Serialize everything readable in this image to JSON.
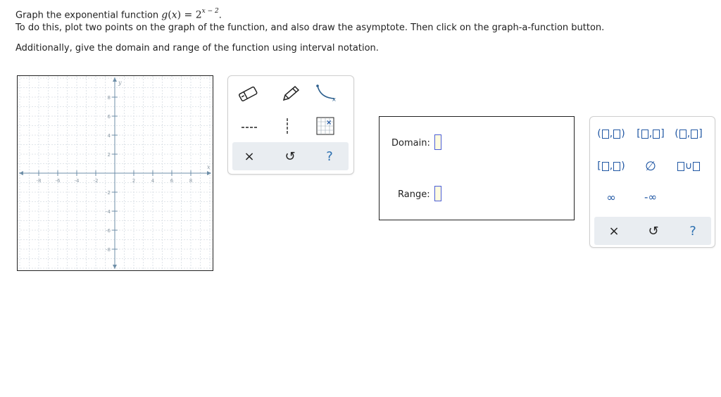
{
  "question": {
    "line1_prefix": "Graph the exponential function ",
    "func_name": "g",
    "func_var": "x",
    "func_eq": " = 2",
    "func_exponent": "x − 2",
    "func_end": ".",
    "line2": "To do this, plot two points on the graph of the function, and also draw the asymptote. Then click on the graph-a-function button.",
    "line3": "Additionally, give the domain and range of the function using interval notation."
  },
  "graph": {
    "x_axis_label": "x",
    "y_axis_label": "y",
    "x_ticks": [
      "-8",
      "-6",
      "-4",
      "-2",
      "2",
      "4",
      "6",
      "8"
    ],
    "y_ticks": [
      "8",
      "6",
      "4",
      "2",
      "-2",
      "-4",
      "-6",
      "-8"
    ],
    "axis_color": "#6f8fa8",
    "grid_color": "#d6dde3"
  },
  "tools": {
    "items": [
      "eraser-icon",
      "pencil-icon",
      "exponential-curve-icon",
      "dashed-line-icon",
      "vertical-dashed-line-icon",
      "graph-a-function-icon"
    ],
    "actions": {
      "clear": "×",
      "undo": "↺",
      "help": "?"
    }
  },
  "answer": {
    "domain_label": "Domain:",
    "range_label": "Range:"
  },
  "keypad": {
    "open_open": "(□,□)",
    "closed_closed": "[□,□]",
    "open_closed": "(□,□]",
    "closed_open": "[□,□)",
    "empty_set": "∅",
    "union": "□∪□",
    "infinity": "∞",
    "neg_infinity": "-∞",
    "actions": {
      "clear": "×",
      "undo": "↺",
      "help": "?"
    },
    "accent": "#1f56a3"
  }
}
